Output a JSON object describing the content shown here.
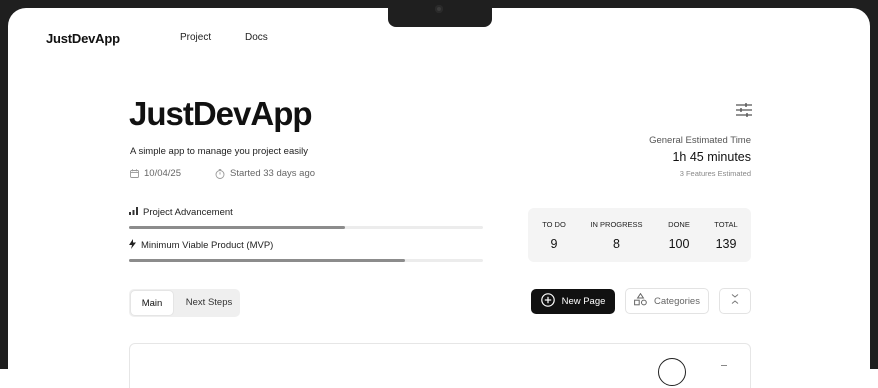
{
  "nav": {
    "brand": "JustDevApp",
    "links": [
      "Project",
      "Docs"
    ]
  },
  "project": {
    "title": "JustDevApp",
    "subtitle": "A simple app to manage you project easily",
    "date": "10/04/25",
    "started": "Started 33 days ago"
  },
  "estimate": {
    "label": "General Estimated Time",
    "value": "1h 45 minutes",
    "note": "3 Features Estimated"
  },
  "progress": [
    {
      "label": "Project Advancement",
      "percent": 61,
      "icon": "bar-chart-icon"
    },
    {
      "label": "Minimum Viable Product (MVP)",
      "percent": 78,
      "icon": "lightning-icon"
    }
  ],
  "stats": {
    "todo": {
      "label": "TO DO",
      "value": "9"
    },
    "in_progress": {
      "label": "IN PROGRESS",
      "value": "8"
    },
    "done": {
      "label": "DONE",
      "value": "100"
    },
    "total": {
      "label": "TOTAL",
      "value": "139"
    }
  },
  "tabs": [
    "Main",
    "Next Steps"
  ],
  "actions": {
    "new_page": "New Page",
    "categories": "Categories"
  },
  "colors": {
    "primary": "#111111",
    "progress_fill": "#8c8c8c",
    "progress_track": "#ececec",
    "stats_bg": "#f4f4f4",
    "frame": "#1f1f1f"
  }
}
